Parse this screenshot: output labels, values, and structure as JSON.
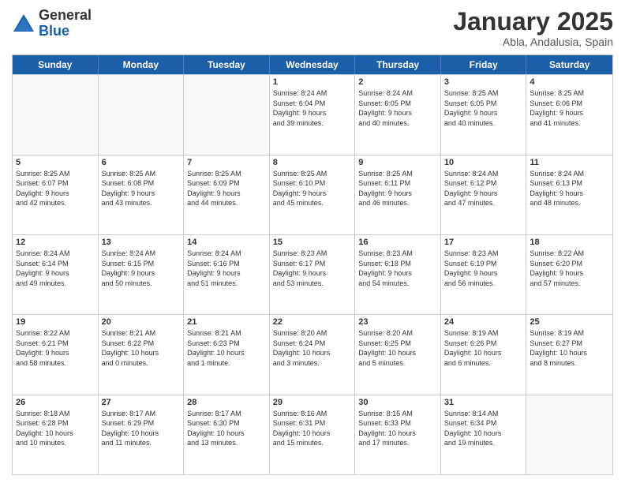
{
  "logo": {
    "general": "General",
    "blue": "Blue"
  },
  "header": {
    "title": "January 2025",
    "subtitle": "Abla, Andalusia, Spain"
  },
  "weekdays": [
    "Sunday",
    "Monday",
    "Tuesday",
    "Wednesday",
    "Thursday",
    "Friday",
    "Saturday"
  ],
  "weeks": [
    [
      {
        "day": "",
        "info": ""
      },
      {
        "day": "",
        "info": ""
      },
      {
        "day": "",
        "info": ""
      },
      {
        "day": "1",
        "info": "Sunrise: 8:24 AM\nSunset: 6:04 PM\nDaylight: 9 hours\nand 39 minutes."
      },
      {
        "day": "2",
        "info": "Sunrise: 8:24 AM\nSunset: 6:05 PM\nDaylight: 9 hours\nand 40 minutes."
      },
      {
        "day": "3",
        "info": "Sunrise: 8:25 AM\nSunset: 6:05 PM\nDaylight: 9 hours\nand 40 minutes."
      },
      {
        "day": "4",
        "info": "Sunrise: 8:25 AM\nSunset: 6:06 PM\nDaylight: 9 hours\nand 41 minutes."
      }
    ],
    [
      {
        "day": "5",
        "info": "Sunrise: 8:25 AM\nSunset: 6:07 PM\nDaylight: 9 hours\nand 42 minutes."
      },
      {
        "day": "6",
        "info": "Sunrise: 8:25 AM\nSunset: 6:08 PM\nDaylight: 9 hours\nand 43 minutes."
      },
      {
        "day": "7",
        "info": "Sunrise: 8:25 AM\nSunset: 6:09 PM\nDaylight: 9 hours\nand 44 minutes."
      },
      {
        "day": "8",
        "info": "Sunrise: 8:25 AM\nSunset: 6:10 PM\nDaylight: 9 hours\nand 45 minutes."
      },
      {
        "day": "9",
        "info": "Sunrise: 8:25 AM\nSunset: 6:11 PM\nDaylight: 9 hours\nand 46 minutes."
      },
      {
        "day": "10",
        "info": "Sunrise: 8:24 AM\nSunset: 6:12 PM\nDaylight: 9 hours\nand 47 minutes."
      },
      {
        "day": "11",
        "info": "Sunrise: 8:24 AM\nSunset: 6:13 PM\nDaylight: 9 hours\nand 48 minutes."
      }
    ],
    [
      {
        "day": "12",
        "info": "Sunrise: 8:24 AM\nSunset: 6:14 PM\nDaylight: 9 hours\nand 49 minutes."
      },
      {
        "day": "13",
        "info": "Sunrise: 8:24 AM\nSunset: 6:15 PM\nDaylight: 9 hours\nand 50 minutes."
      },
      {
        "day": "14",
        "info": "Sunrise: 8:24 AM\nSunset: 6:16 PM\nDaylight: 9 hours\nand 51 minutes."
      },
      {
        "day": "15",
        "info": "Sunrise: 8:23 AM\nSunset: 6:17 PM\nDaylight: 9 hours\nand 53 minutes."
      },
      {
        "day": "16",
        "info": "Sunrise: 8:23 AM\nSunset: 6:18 PM\nDaylight: 9 hours\nand 54 minutes."
      },
      {
        "day": "17",
        "info": "Sunrise: 8:23 AM\nSunset: 6:19 PM\nDaylight: 9 hours\nand 56 minutes."
      },
      {
        "day": "18",
        "info": "Sunrise: 8:22 AM\nSunset: 6:20 PM\nDaylight: 9 hours\nand 57 minutes."
      }
    ],
    [
      {
        "day": "19",
        "info": "Sunrise: 8:22 AM\nSunset: 6:21 PM\nDaylight: 9 hours\nand 58 minutes."
      },
      {
        "day": "20",
        "info": "Sunrise: 8:21 AM\nSunset: 6:22 PM\nDaylight: 10 hours\nand 0 minutes."
      },
      {
        "day": "21",
        "info": "Sunrise: 8:21 AM\nSunset: 6:23 PM\nDaylight: 10 hours\nand 1 minute."
      },
      {
        "day": "22",
        "info": "Sunrise: 8:20 AM\nSunset: 6:24 PM\nDaylight: 10 hours\nand 3 minutes."
      },
      {
        "day": "23",
        "info": "Sunrise: 8:20 AM\nSunset: 6:25 PM\nDaylight: 10 hours\nand 5 minutes."
      },
      {
        "day": "24",
        "info": "Sunrise: 8:19 AM\nSunset: 6:26 PM\nDaylight: 10 hours\nand 6 minutes."
      },
      {
        "day": "25",
        "info": "Sunrise: 8:19 AM\nSunset: 6:27 PM\nDaylight: 10 hours\nand 8 minutes."
      }
    ],
    [
      {
        "day": "26",
        "info": "Sunrise: 8:18 AM\nSunset: 6:28 PM\nDaylight: 10 hours\nand 10 minutes."
      },
      {
        "day": "27",
        "info": "Sunrise: 8:17 AM\nSunset: 6:29 PM\nDaylight: 10 hours\nand 11 minutes."
      },
      {
        "day": "28",
        "info": "Sunrise: 8:17 AM\nSunset: 6:30 PM\nDaylight: 10 hours\nand 13 minutes."
      },
      {
        "day": "29",
        "info": "Sunrise: 8:16 AM\nSunset: 6:31 PM\nDaylight: 10 hours\nand 15 minutes."
      },
      {
        "day": "30",
        "info": "Sunrise: 8:15 AM\nSunset: 6:33 PM\nDaylight: 10 hours\nand 17 minutes."
      },
      {
        "day": "31",
        "info": "Sunrise: 8:14 AM\nSunset: 6:34 PM\nDaylight: 10 hours\nand 19 minutes."
      },
      {
        "day": "",
        "info": ""
      }
    ]
  ]
}
